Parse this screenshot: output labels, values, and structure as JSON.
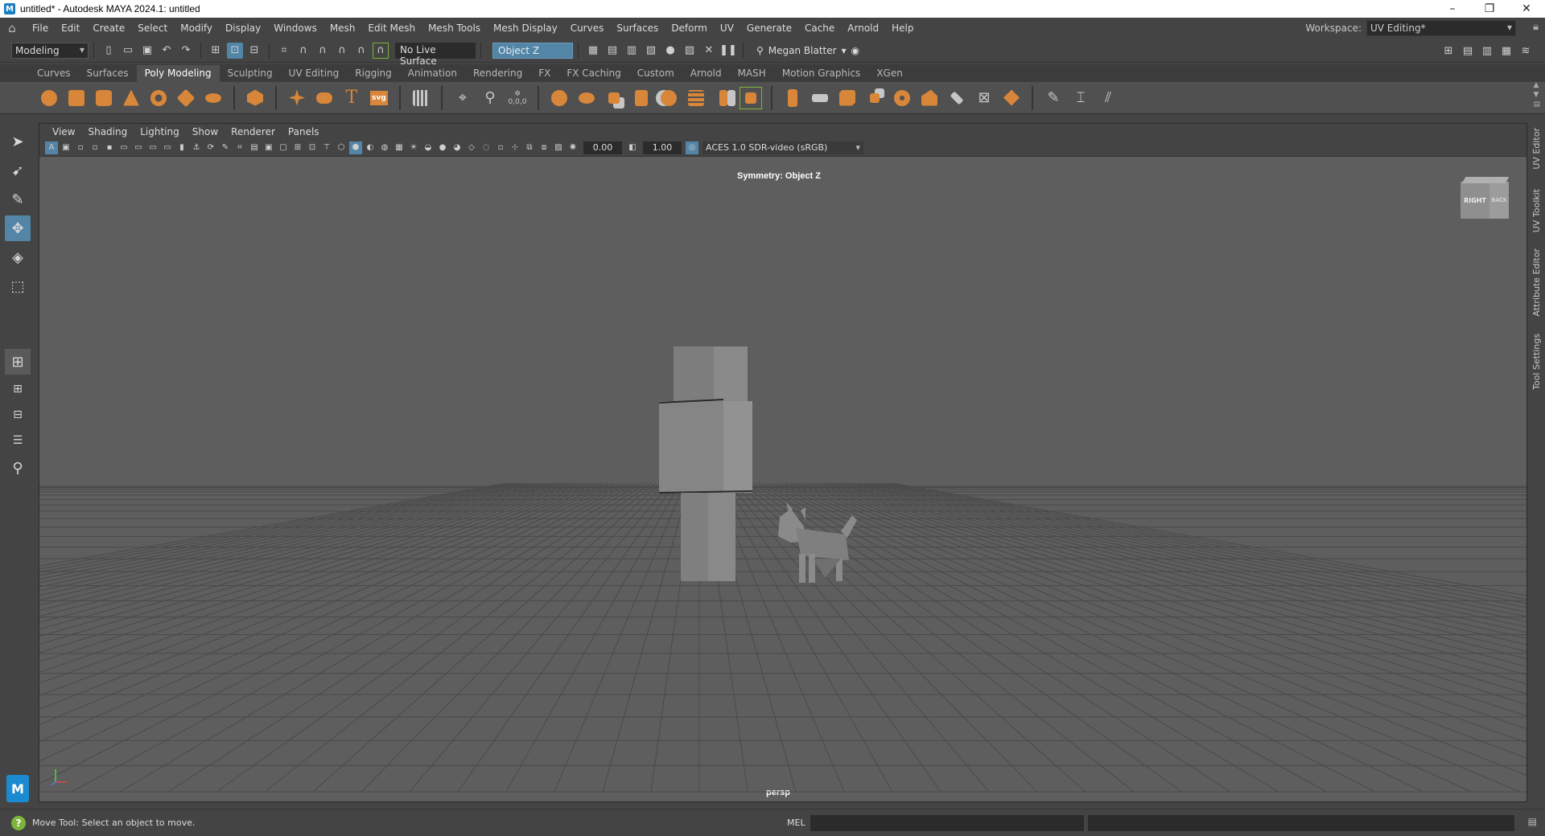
{
  "window": {
    "title": "untitled* - Autodesk MAYA 2024.1: untitled",
    "app_icon": "M",
    "controls": [
      "–",
      "❐",
      "✕"
    ]
  },
  "menu": {
    "items": [
      "File",
      "Edit",
      "Create",
      "Select",
      "Modify",
      "Display",
      "Windows",
      "Mesh",
      "Edit Mesh",
      "Mesh Tools",
      "Mesh Display",
      "Curves",
      "Surfaces",
      "Deform",
      "UV",
      "Generate",
      "Cache",
      "Arnold",
      "Help"
    ],
    "workspace_label": "Workspace:",
    "workspace_value": "UV Editing*"
  },
  "statusline": {
    "mode": "Modeling",
    "live_surface": "No Live Surface",
    "symmetry_field": "Object Z",
    "user": "Megan Blatter"
  },
  "shelf": {
    "tabs": [
      "Curves",
      "Surfaces",
      "Poly Modeling",
      "Sculpting",
      "UV Editing",
      "Rigging",
      "Animation",
      "Rendering",
      "FX",
      "FX Caching",
      "Custom",
      "Arnold",
      "MASH",
      "Motion Graphics",
      "XGen"
    ],
    "active_tab": "Poly Modeling",
    "svg_label": "svg",
    "text_label": "T",
    "coord_label": "0,0,0"
  },
  "viewport": {
    "panel_menu": [
      "View",
      "Shading",
      "Lighting",
      "Show",
      "Renderer",
      "Panels"
    ],
    "exposure": "0.00",
    "gamma": "1.00",
    "color_space": "ACES 1.0 SDR-video (sRGB)",
    "symmetry_label": "Symmetry: Object Z",
    "camera_label": "persp",
    "viewcube_right": "RIGHT",
    "viewcube_back": "BACK"
  },
  "right_tabs": [
    "UV Editor",
    "UV Toolkit",
    "Attribute Editor",
    "Tool Settings"
  ],
  "helpline": {
    "text": "Move Tool: Select an object to move.",
    "mel_label": "MEL"
  },
  "colors": {
    "accent": "#5285a6",
    "shelf_icon": "#d8863a",
    "viewport_bg": "#5e5e5e",
    "help_icon": "#7db43a",
    "maya_logo": "#1a8bd1"
  }
}
